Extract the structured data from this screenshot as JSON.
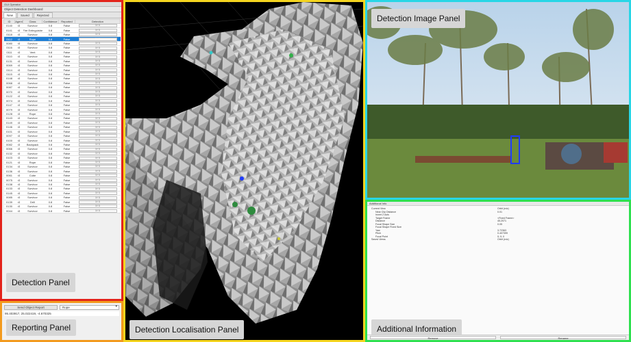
{
  "detection_panel": {
    "window_title": "GUI Operator",
    "subtitle": "Object Detection Dashboard",
    "tabs": [
      "New",
      "Saved",
      "Rejected"
    ],
    "columns": [
      "ID",
      "Agent",
      "Class",
      "Confidence",
      "Reported",
      "Detection"
    ],
    "rows": [
      [
        "0140",
        "r3",
        "Survivor",
        "0.8",
        "False",
        "1 / 1"
      ],
      [
        "0141",
        "r3",
        "Fire Extinguisher",
        "0.8",
        "False",
        "1 / 1"
      ],
      [
        "0118",
        "r3",
        "Survivor",
        "0.8",
        "False",
        "1 / 1"
      ],
      [
        "0112",
        "r3",
        "Rope",
        "0.8",
        "False",
        "1 / 1"
      ],
      [
        "0080",
        "r3",
        "Survivor",
        "0.8",
        "False",
        "1 / 1"
      ],
      [
        "0116",
        "r3",
        "Survivor",
        "0.8",
        "False",
        "1 / 1"
      ],
      [
        "0111",
        "r3",
        "Vent",
        "0.8",
        "False",
        "1 / 1"
      ],
      [
        "0110",
        "r3",
        "Survivor",
        "0.8",
        "False",
        "1 / 1"
      ],
      [
        "0131",
        "r3",
        "Survivor",
        "0.8",
        "False",
        "1 / 1"
      ],
      [
        "0069",
        "r3",
        "Survivor",
        "0.8",
        "False",
        "1 / 1"
      ],
      [
        "0114",
        "r3",
        "Survivor",
        "0.8",
        "False",
        "1 / 1"
      ],
      [
        "0115",
        "r3",
        "Survivor",
        "0.8",
        "False",
        "1 / 1"
      ],
      [
        "0148",
        "r3",
        "Survivor",
        "0.8",
        "False",
        "1 / 1"
      ],
      [
        "0068",
        "r3",
        "Survivor",
        "0.8",
        "False",
        "1 / 1"
      ],
      [
        "0087",
        "r3",
        "Survivor",
        "0.8",
        "False",
        "1 / 1"
      ],
      [
        "0070",
        "r3",
        "Survivor",
        "0.8",
        "False",
        "1 / 1"
      ],
      [
        "0122",
        "r3",
        "Survivor",
        "0.8",
        "False",
        "1 / 1"
      ],
      [
        "0074",
        "r3",
        "Survivor",
        "0.8",
        "False",
        "1 / 1"
      ],
      [
        "0147",
        "r3",
        "Survivor",
        "0.8",
        "False",
        "1 / 1"
      ],
      [
        "0079",
        "r3",
        "Survivor",
        "0.8",
        "False",
        "1 / 1"
      ],
      [
        "0128",
        "r3",
        "Rope",
        "0.8",
        "False",
        "1 / 1"
      ],
      [
        "0143",
        "r3",
        "Survivor",
        "0.8",
        "False",
        "1 / 1"
      ],
      [
        "0149",
        "r3",
        "Survivor",
        "0.8",
        "False",
        "1 / 1"
      ],
      [
        "0146",
        "r3",
        "Survivor",
        "0.8",
        "False",
        "1 / 1"
      ],
      [
        "0101",
        "r3",
        "Survivor",
        "0.8",
        "False",
        "1 / 1"
      ],
      [
        "0097",
        "r3",
        "Survivor",
        "0.8",
        "False",
        "1 / 1"
      ],
      [
        "0100",
        "r3",
        "Survivor",
        "0.8",
        "False",
        "1 / 1"
      ],
      [
        "0082",
        "r3",
        "Backpack",
        "0.8",
        "False",
        "1 / 1"
      ],
      [
        "0066",
        "r3",
        "Survivor",
        "0.8",
        "False",
        "1 / 1"
      ],
      [
        "0132",
        "r3",
        "Survivor",
        "0.8",
        "False",
        "1 / 1"
      ],
      [
        "0103",
        "r3",
        "Survivor",
        "0.8",
        "False",
        "1 / 1"
      ],
      [
        "0121",
        "r3",
        "Rope",
        "0.8",
        "False",
        "1 / 1"
      ],
      [
        "0134",
        "r3",
        "Survivor",
        "0.8",
        "False",
        "1 / 1"
      ],
      [
        "0136",
        "r3",
        "Survivor",
        "0.8",
        "False",
        "1 / 1"
      ],
      [
        "0061",
        "r3",
        "Cube",
        "0.8",
        "False",
        "1 / 1"
      ],
      [
        "0075",
        "r3",
        "Survivor",
        "0.8",
        "False",
        "1 / 1"
      ],
      [
        "0138",
        "r3",
        "Survivor",
        "0.8",
        "False",
        "1 / 1"
      ],
      [
        "0133",
        "r3",
        "Survivor",
        "0.8",
        "False",
        "1 / 1"
      ],
      [
        "0145",
        "r3",
        "Survivor",
        "0.8",
        "False",
        "1 / 1"
      ],
      [
        "0085",
        "r3",
        "Survivor",
        "0.8",
        "False",
        "1 / 1"
      ],
      [
        "0139",
        "r3",
        "Drill",
        "0.8",
        "False",
        "1 / 1"
      ],
      [
        "0130",
        "r3",
        "Survivor",
        "0.8",
        "False",
        "1 / 1"
      ],
      [
        "0044",
        "r3",
        "Survivor",
        "0.8",
        "False",
        "1 / 1"
      ]
    ],
    "selected_row": 3,
    "label": "Detection Panel"
  },
  "reporting_panel": {
    "send_button": "Send Object Report",
    "class_select": "Rope",
    "coordinates": "95.403917, 25.022419, -4.670325",
    "label": "Reporting Panel"
  },
  "localisation_panel": {
    "label": "Detection Localisation Panel"
  },
  "image_panel": {
    "label": "Detection Image Panel"
  },
  "info_panel": {
    "title": "Additional Info",
    "rows": [
      [
        "Current View",
        "Orbit (rviz)"
      ],
      [
        "Near Clip Distance",
        "0.01"
      ],
      [
        "Invert Z Axis",
        ""
      ],
      [
        "Target Frame",
        "<Fixed Frame>"
      ],
      [
        "Distance",
        "45.2071"
      ],
      [
        "Focal Shape Size",
        "0.05"
      ],
      [
        "Focal Shape Fixed Size",
        ""
      ],
      [
        "Yaw",
        "3.72363"
      ],
      [
        "Pitch",
        "0.407399"
      ],
      [
        "Focal Point",
        "0; 0; 0"
      ],
      [
        "Saved Views",
        "Orbit (rviz)"
      ]
    ],
    "foot_buttons": [
      "Remove",
      "Rename"
    ],
    "label": "Additional Information"
  },
  "colors": {
    "detection": "#e3231b",
    "reporting": "#f39a1e",
    "localisation": "#f5d51f",
    "image": "#28d6e6",
    "info": "#2ee04f",
    "selection": "#1e7fd6"
  }
}
